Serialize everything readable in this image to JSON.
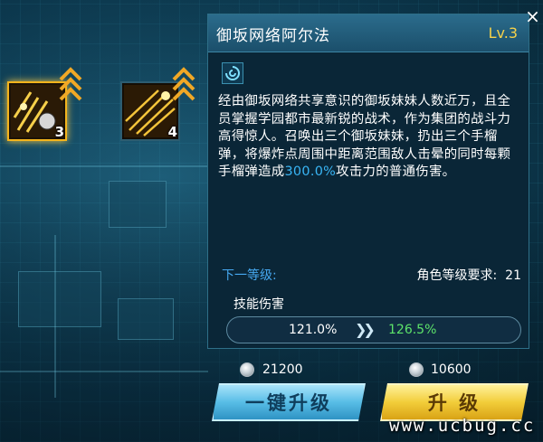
{
  "skills": [
    {
      "number": "3",
      "selected": true,
      "icon": "missile-swarm-skill-icon"
    },
    {
      "number": "4",
      "selected": false,
      "icon": "bullet-barrage-skill-icon"
    }
  ],
  "panel": {
    "title": "御坂网络阿尔法",
    "level": "Lv.3",
    "type_icon": "swirl-icon",
    "description_before": "经由御坂网络共享意识的御坂妹妹人数近万，且全员掌握学园都市最新锐的战术，作为集团的战斗力高得惊人。召唤出三个御坂妹妹，扔出三个手榴弹，将爆炸点周围中距离范围敌人击晕的同时每颗手榴弹造成",
    "description_highlight": "300.0%",
    "description_after": "攻击力的普通伤害。",
    "next_level_label": "下一等级:",
    "requirement_label": "角色等级要求:",
    "requirement_value": "21",
    "stat_label": "技能伤害",
    "stat_current": "121.0%",
    "stat_next": "126.5%"
  },
  "costs": {
    "one_click": "21200",
    "single": "10600"
  },
  "buttons": {
    "one_click_upgrade": "一键升级",
    "upgrade": "升 级"
  },
  "watermark": "www.ucbug.cc",
  "colors": {
    "accent_blue": "#46a8f0",
    "level_gold": "#f6d24a",
    "increase_green": "#5de36a",
    "highlight_blue": "#39b6f6"
  }
}
